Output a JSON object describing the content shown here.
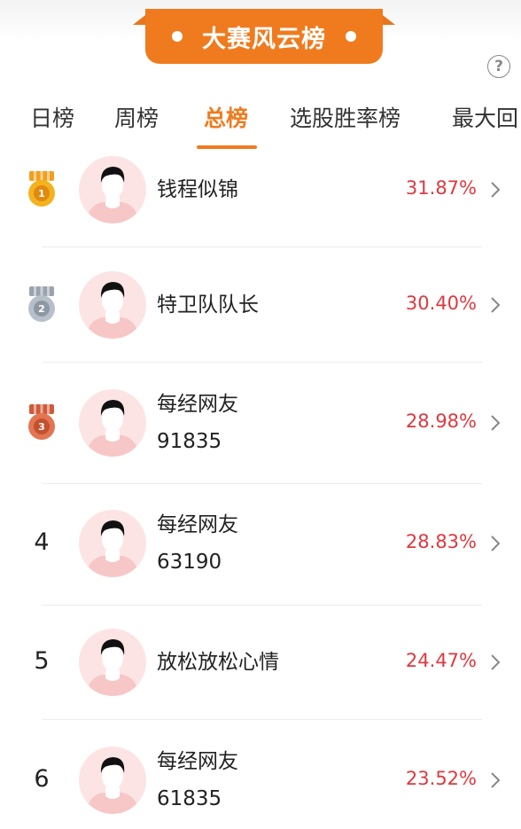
{
  "banner": {
    "title": "大赛风云榜"
  },
  "help": {
    "label": "?"
  },
  "tabs": [
    {
      "label": "日榜",
      "active": false
    },
    {
      "label": "周榜",
      "active": false
    },
    {
      "label": "总榜",
      "active": true
    },
    {
      "label": "选股胜率榜",
      "active": false
    },
    {
      "label": "最大回",
      "active": false
    }
  ],
  "colors": {
    "accent": "#f07b1e",
    "percent": "#e0383e",
    "avatar_bg": "#fde4e4"
  },
  "rankings": [
    {
      "rank": "1",
      "medal": "gold",
      "name_line1": "钱程似锦",
      "name_line2": "",
      "percent": "31.87%"
    },
    {
      "rank": "2",
      "medal": "silver",
      "name_line1": "特卫队队长",
      "name_line2": "",
      "percent": "30.40%"
    },
    {
      "rank": "3",
      "medal": "bronze",
      "name_line1": "每经网友",
      "name_line2": "91835",
      "percent": "28.98%"
    },
    {
      "rank": "4",
      "medal": "",
      "name_line1": "每经网友",
      "name_line2": "63190",
      "percent": "28.83%"
    },
    {
      "rank": "5",
      "medal": "",
      "name_line1": "放松放松心情",
      "name_line2": "",
      "percent": "24.47%"
    },
    {
      "rank": "6",
      "medal": "",
      "name_line1": "每经网友",
      "name_line2": "61835",
      "percent": "23.52%"
    }
  ]
}
